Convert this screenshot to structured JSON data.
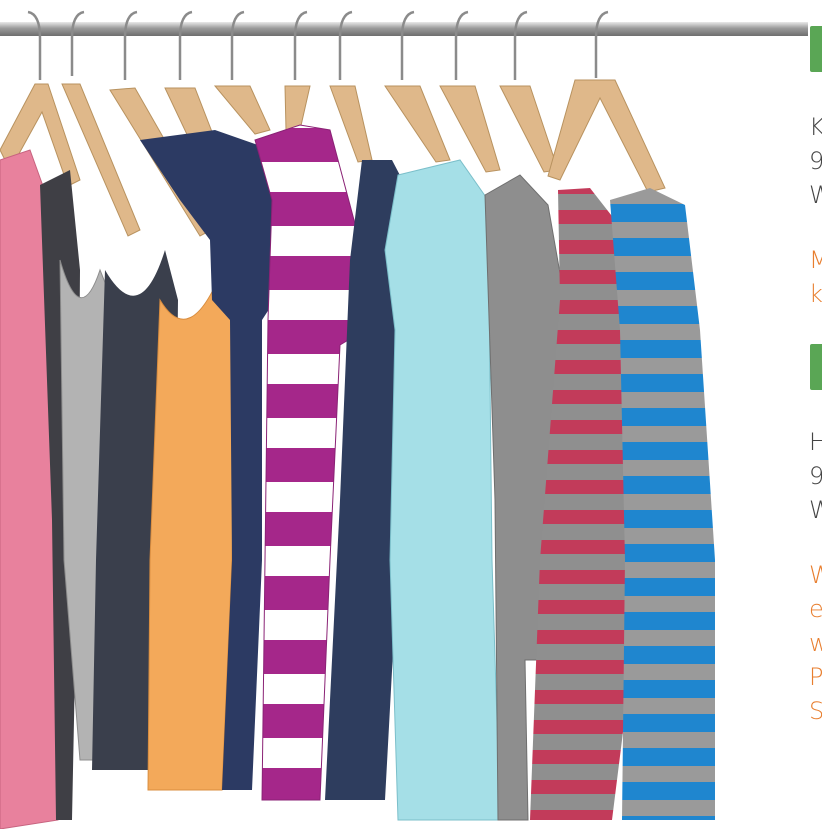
{
  "colors": {
    "accent_green": "#5aa655",
    "text_gray": "#444444",
    "text_orange": "#e87e2e"
  },
  "sidebar": {
    "section1": {
      "lines": [
        "K",
        "9",
        "W"
      ],
      "link_lines": [
        "M",
        "k"
      ]
    },
    "section2": {
      "lines": [
        "H",
        "9",
        "W"
      ],
      "link_lines": [
        "W",
        "e",
        "w",
        "P",
        "S"
      ]
    }
  }
}
